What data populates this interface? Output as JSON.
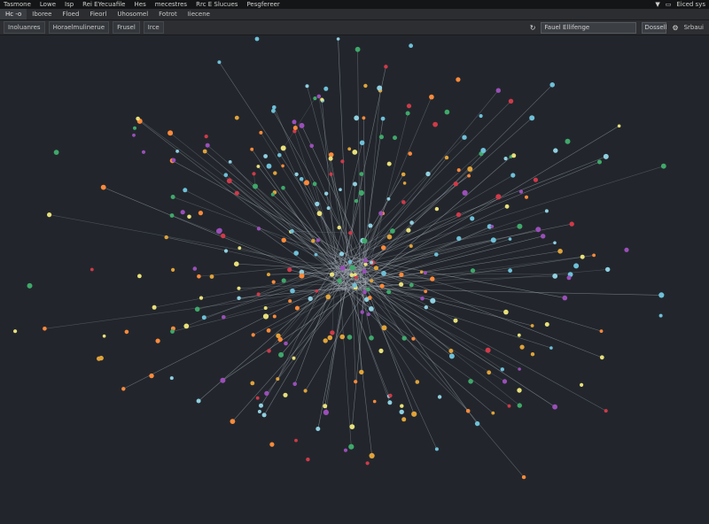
{
  "menubar": {
    "items": [
      "Tasmone",
      "Lowe",
      "Isp",
      "Rei EYecuafile",
      "Hes",
      "mecestres",
      "Rrc E Slucues",
      "Pesgfereer"
    ],
    "right": {
      "filter_icon": "filter-icon",
      "window_icon": "window-icon",
      "account_label": "Eiced sys"
    }
  },
  "toolbar1": {
    "items": [
      "Hc -o",
      "Iboree",
      "Floed",
      "Fieorl",
      "Uhosomel",
      "Fotrot",
      "Iiecene"
    ]
  },
  "toolbar2": {
    "buttons": [
      "Inoluanres",
      "Horaelmulinerue",
      "Frusel",
      "Irce"
    ],
    "search": {
      "value": "Fauel Ellifenge",
      "icon": "refresh-icon"
    },
    "field_value": "Dossell",
    "settings_icon": "settings-icon",
    "extra_label": "Srbaui"
  },
  "graph": {
    "node_colors": [
      "#e0a33a",
      "#d03a49",
      "#3fa86a",
      "#8fd0e0",
      "#e8e07a",
      "#9a4fb8",
      "#ff8a3a",
      "#6ec0d8"
    ],
    "edge_color": "#aab2bb"
  }
}
